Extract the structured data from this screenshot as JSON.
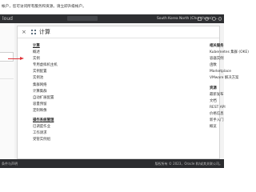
{
  "banner": {
    "text": "帐户，您可访问所有服务和资源。请立即升级帐户。"
  },
  "topbar": {
    "logo": "loud",
    "region": "South Korea North (Chuncheon)",
    "region_chevron": "⌄"
  },
  "dialog": {
    "close": "×",
    "title": "计算",
    "left_column": {
      "section1": {
        "title": "计算",
        "items": [
          "概述",
          "实例",
          "专用虚拟机主机",
          "实例配置",
          "实例池",
          "集群网络",
          "计算集群",
          "自动扩展配置",
          "容量预留",
          "定制映像"
        ]
      },
      "section2": {
        "title": "操作系统管理",
        "items": [
          "已调度作业",
          "工作请求",
          "受管实例组"
        ]
      }
    },
    "right_column": {
      "section1": {
        "title": "相关服务",
        "items": [
          "Kubernetes 集群 (OKE)",
          "容器实例",
          "函数",
          "Marketplace",
          "VMware 解决方案"
        ]
      },
      "section2": {
        "title": "资源",
        "items": [
          "最新发布",
          "文档",
          "REST API",
          "价格信息",
          "新手入门",
          "概览"
        ]
      }
    }
  },
  "footer": {
    "left": "条件与声明",
    "right": "版权所有 © 2023，Oracle 和/或其关联公司。"
  },
  "colors": {
    "topbar": "#2e2f32",
    "arrow": "#e0353b",
    "footer": "#2b2c2f"
  }
}
